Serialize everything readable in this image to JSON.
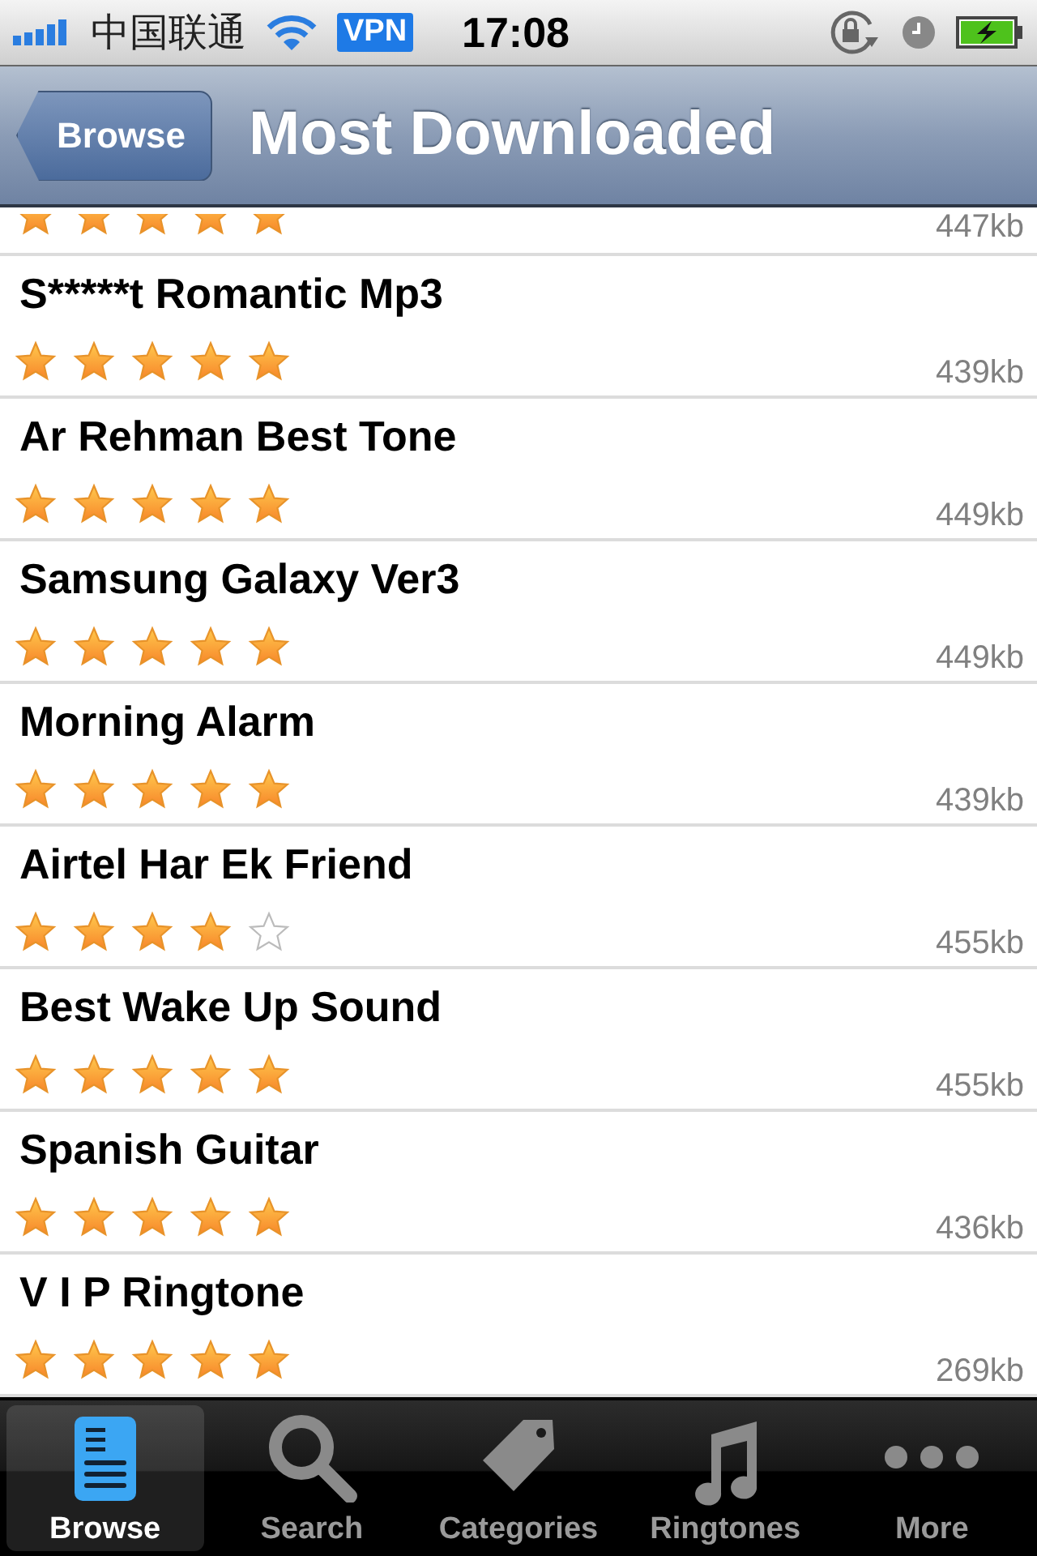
{
  "status_bar": {
    "carrier": "中国联通",
    "vpn": "VPN",
    "time": "17:08"
  },
  "nav_bar": {
    "back": "Browse",
    "title": "Most Downloaded"
  },
  "rows": [
    {
      "stars": 5,
      "size": "447kb"
    },
    {
      "title": "S*****t Romantic Mp3",
      "stars": 5,
      "size": "439kb"
    },
    {
      "title": "Ar Rehman Best Tone",
      "stars": 5,
      "size": "449kb"
    },
    {
      "title": "Samsung Galaxy Ver3",
      "stars": 5,
      "size": "449kb"
    },
    {
      "title": "Morning Alarm",
      "stars": 5,
      "size": "439kb"
    },
    {
      "title": "Airtel Har Ek Friend",
      "stars": 4,
      "size": "455kb"
    },
    {
      "title": "Best Wake Up Sound",
      "stars": 5,
      "size": "455kb"
    },
    {
      "title": "Spanish Guitar",
      "stars": 5,
      "size": "436kb"
    },
    {
      "title": "V I P Ringtone",
      "stars": 5,
      "size": "269kb"
    }
  ],
  "tab_bar": [
    {
      "kind": "browse",
      "label": "Browse",
      "selected": true
    },
    {
      "kind": "search",
      "label": "Search",
      "selected": false
    },
    {
      "kind": "categories",
      "label": "Categories",
      "selected": false
    },
    {
      "kind": "ringtones",
      "label": "Ringtones",
      "selected": false
    },
    {
      "kind": "more",
      "label": "More",
      "selected": false
    }
  ]
}
